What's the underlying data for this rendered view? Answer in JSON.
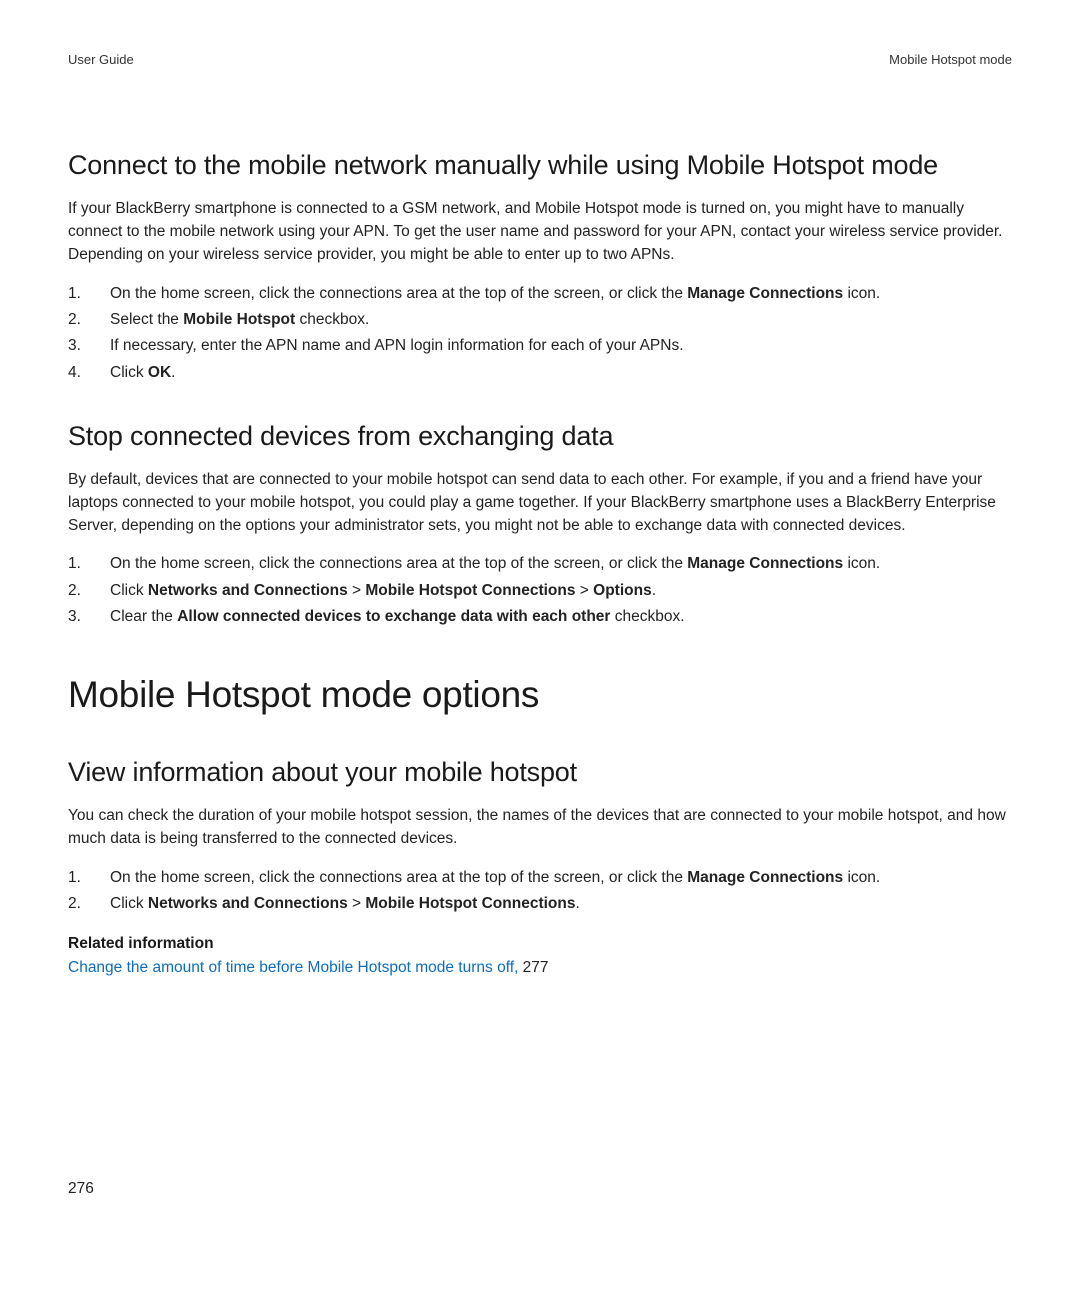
{
  "header": {
    "left": "User Guide",
    "right": "Mobile Hotspot mode"
  },
  "section1": {
    "title": "Connect to the mobile network manually while using Mobile Hotspot mode",
    "para": "If your BlackBerry smartphone is connected to a GSM network, and Mobile Hotspot mode is turned on, you might have to manually connect to the mobile network using your APN. To get the user name and password for your APN, contact your wireless service provider. Depending on your wireless service provider, you might be able to enter up to two APNs.",
    "steps": {
      "s1a": "On the home screen, click the connections area at the top of the screen, or click the ",
      "s1b": "Manage Connections",
      "s1c": " icon.",
      "s2a": "Select the ",
      "s2b": "Mobile Hotspot",
      "s2c": " checkbox.",
      "s3": "If necessary, enter the APN name and APN login information for each of your APNs.",
      "s4a": "Click ",
      "s4b": "OK",
      "s4c": "."
    }
  },
  "section2": {
    "title": "Stop connected devices from exchanging data",
    "para": "By default, devices that are connected to your mobile hotspot can send data to each other. For example, if you and a friend have your laptops connected to your mobile hotspot, you could play a game together. If your BlackBerry smartphone uses a BlackBerry Enterprise Server, depending on the options your administrator sets, you might not be able to exchange data with connected devices.",
    "steps": {
      "s1a": "On the home screen, click the connections area at the top of the screen, or click the ",
      "s1b": "Manage Connections",
      "s1c": " icon.",
      "s2a": "Click ",
      "s2b": "Networks and Connections",
      "s2sep1": " > ",
      "s2c": "Mobile Hotspot Connections",
      "s2sep2": " > ",
      "s2d": "Options",
      "s2e": ".",
      "s3a": "Clear the ",
      "s3b": "Allow connected devices to exchange data with each other",
      "s3c": " checkbox."
    }
  },
  "major": {
    "title": "Mobile Hotspot mode options"
  },
  "section3": {
    "title": "View information about your mobile hotspot",
    "para": "You can check the duration of your mobile hotspot session, the names of the devices that are connected to your mobile hotspot, and how much data is being transferred to the connected devices.",
    "steps": {
      "s1a": "On the home screen, click the connections area at the top of the screen, or click the ",
      "s1b": "Manage Connections",
      "s1c": " icon.",
      "s2a": "Click ",
      "s2b": "Networks and Connections",
      "s2sep": " > ",
      "s2c": "Mobile Hotspot Connections",
      "s2d": "."
    }
  },
  "related": {
    "header": "Related information",
    "link_text": "Change the amount of time before Mobile Hotspot mode turns off, ",
    "link_page": "277"
  },
  "pagenum": "276"
}
